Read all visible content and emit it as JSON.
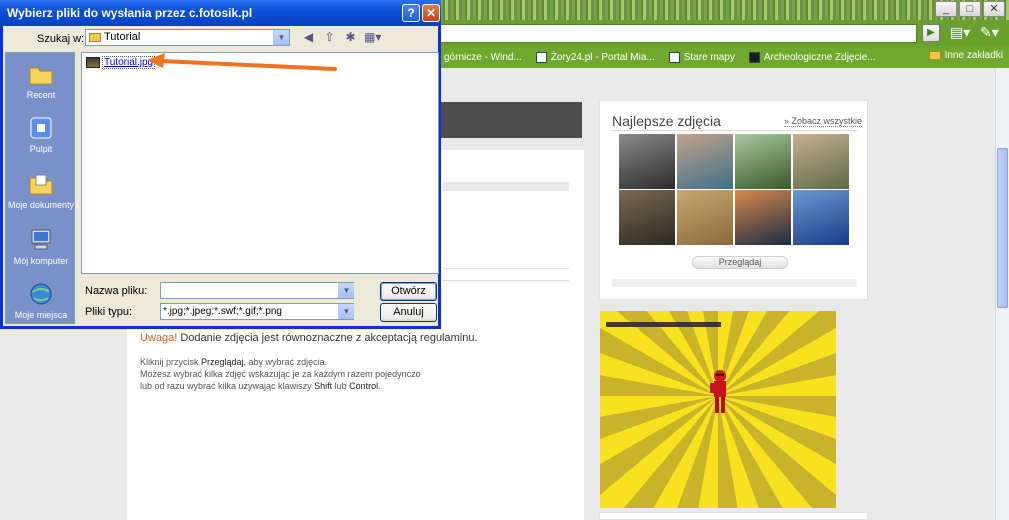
{
  "browser": {
    "window_controls": [
      "_",
      "□",
      "✕"
    ],
    "go_label": "▶",
    "page_menu": "▤▾",
    "wrench_menu": "✎▾",
    "bookmarks": [
      {
        "label": "górnicze - Wind...",
        "icon": "none"
      },
      {
        "label": "Żory24.pl - Portal Mia...",
        "icon": "page"
      },
      {
        "label": "Stare mapy",
        "icon": "page"
      },
      {
        "label": "Archeologiczne Zdjęcie...",
        "icon": "dark"
      }
    ],
    "other_bookmarks": "Inne zakładki"
  },
  "page": {
    "warning_label": "Uwaga!",
    "warning_text": " Dodanie zdjęcia jest równoznaczne z akceptacją regulaminu.",
    "instructions": {
      "line1_pre": "Kliknij przycisk ",
      "line1_bold": "Przeglądaj",
      "line1_post": ", aby wybrać zdjęcia.",
      "line2": "Możesz wybrać kilka zdjęć wskazując je za każdym razem pojedynczo",
      "line3_pre": "lub od razu wybrać kilka używając klawiszy ",
      "line3_key1": "Shift",
      "line3_mid": " lub ",
      "line3_key2": "Control",
      "line3_post": "."
    },
    "best_photos": {
      "title": "Najlepsze zdjęcia",
      "see_all": "» Zobacz wszystkie",
      "browse_button": "Przeglądaj",
      "thumb_colors": [
        [
          "#2b2b2b",
          "#8b8b8b"
        ],
        [
          "#3f6f8a",
          "#c2a28a"
        ],
        [
          "#3a5a2a",
          "#a8c8a0"
        ],
        [
          "#5a6a4a",
          "#c8b090"
        ],
        [
          "#2a2a22",
          "#7a6a50"
        ],
        [
          "#8a6a3a",
          "#c8a870"
        ],
        [
          "#1a2a44",
          "#d88a4a"
        ],
        [
          "#1a3a8a",
          "#6a9ad0"
        ]
      ]
    }
  },
  "dialog": {
    "title": "Wybierz pliki do wysłania przez c.fotosik.pl",
    "help_label": "?",
    "close_label": "✕",
    "look_in_label": "Szukaj w:",
    "look_in_value": "Tutorial",
    "toolbar_icons": [
      "back-icon",
      "up-folder-icon",
      "new-folder-icon",
      "views-icon"
    ],
    "toolbar_glyphs": [
      "◀",
      "⇧",
      "✱",
      "▦▾"
    ],
    "places": [
      {
        "label": "Recent",
        "icon": "recent-folder-icon"
      },
      {
        "label": "Pulpit",
        "icon": "desktop-icon"
      },
      {
        "label": "Moje dokumenty",
        "icon": "my-documents-icon"
      },
      {
        "label": "Mój komputer",
        "icon": "my-computer-icon"
      },
      {
        "label": "Moje miejsca",
        "icon": "network-places-icon"
      }
    ],
    "files": [
      {
        "name": "Tutorial.jpg"
      }
    ],
    "file_name_label": "Nazwa pliku:",
    "file_name_value": "",
    "file_type_label": "Pliki typu:",
    "file_type_value": "*.jpg;*.jpeg;*.swf;*.gif;*.png",
    "open_button": "Otwórz",
    "cancel_button": "Anuluj",
    "annotation_arrow_color": "#f0721f"
  }
}
